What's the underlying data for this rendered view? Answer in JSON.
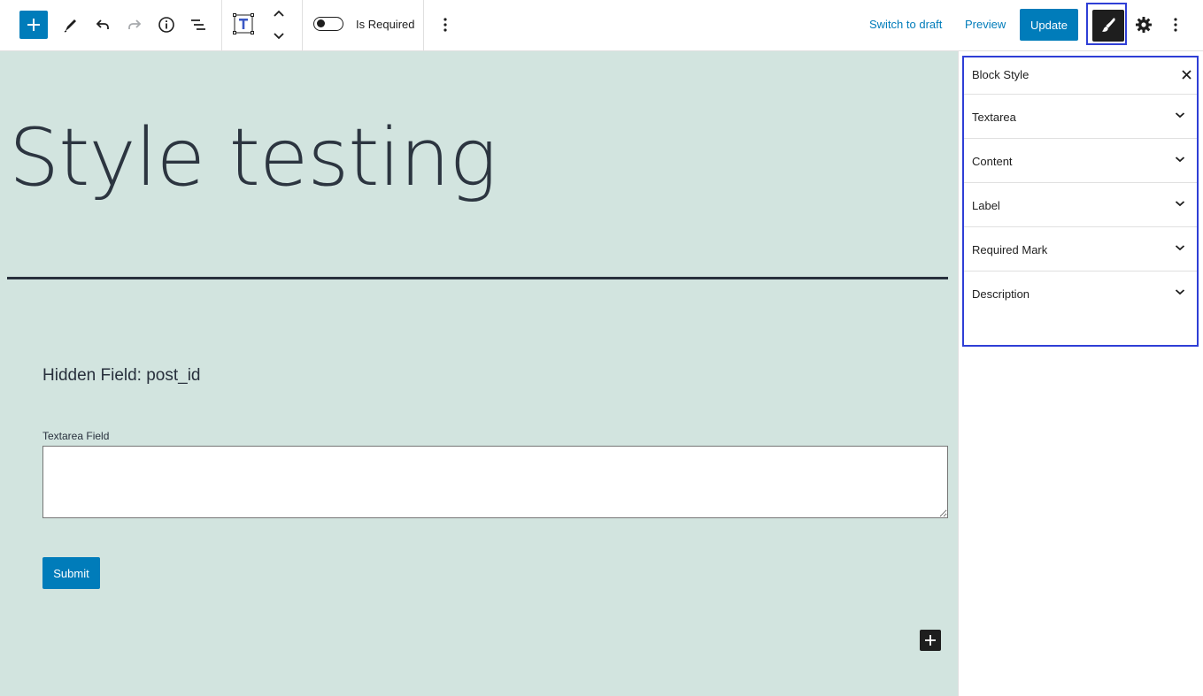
{
  "toolbar": {
    "add_block_icon": "plus-icon",
    "tools_icon": "pencil-icon",
    "undo_icon": "undo-icon",
    "redo_icon": "redo-icon",
    "details_icon": "info-icon",
    "list_view_icon": "list-view-icon",
    "block_type_icon": "text-field-block-icon",
    "move_up_icon": "chevron-up-icon",
    "move_down_icon": "chevron-down-icon",
    "required_toggle_label": "Is Required",
    "required_toggle_on": false,
    "block_options_icon": "more-vertical-icon",
    "switch_to_draft": "Switch to draft",
    "preview": "Preview",
    "update": "Update",
    "block_style_icon": "brush-icon",
    "settings_icon": "gear-icon",
    "options_icon": "more-vertical-icon"
  },
  "canvas": {
    "background": "#d2e4df",
    "post_title": "Style testing",
    "hidden_field_text": "Hidden Field: post_id",
    "textarea_label": "Textarea Field",
    "textarea_value": "",
    "submit_label": "Submit",
    "inserter_icon": "plus-icon"
  },
  "sidebar": {
    "panel_title": "Block Style",
    "close_icon": "close-icon",
    "sections": [
      {
        "label": "Textarea",
        "expanded": false
      },
      {
        "label": "Content",
        "expanded": false
      },
      {
        "label": "Label",
        "expanded": false
      },
      {
        "label": "Required Mark",
        "expanded": false
      },
      {
        "label": "Description",
        "expanded": false
      }
    ]
  },
  "colors": {
    "accent": "#007cba",
    "highlight_outline": "#2f3fd6",
    "text_dark": "#1e1e1e",
    "title_text": "#2c3540"
  }
}
